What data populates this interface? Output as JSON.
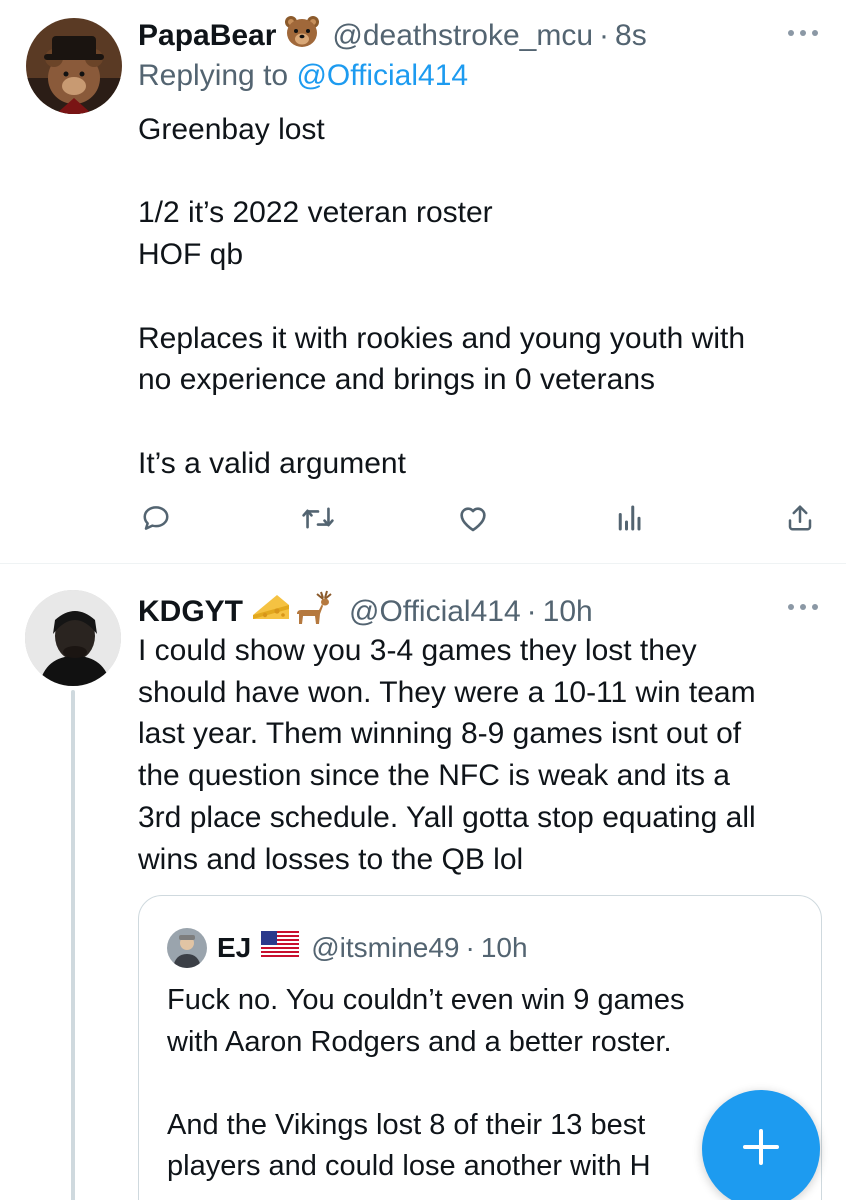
{
  "tweet1": {
    "name": "PapaBear",
    "emoji": "bear-face-emoji",
    "handle": "@deathstroke_mcu",
    "separator": "·",
    "time": "8s",
    "reply_prefix": "Replying to",
    "reply_to": "@Official414",
    "text": "Greenbay lost\n\n1/2 it’s 2022 veteran roster\nHOF qb\n\nReplaces it with rookies and young youth with\nno experience  and brings in 0 veterans\n\nIt’s a valid argument",
    "actions": [
      "reply-icon",
      "retweet-icon",
      "like-icon",
      "views-icon",
      "share-icon"
    ]
  },
  "tweet2": {
    "name": "KDGYT",
    "emojis": [
      "cheese-emoji",
      "deer-emoji"
    ],
    "handle": "@Official414",
    "separator": "·",
    "time": "10h",
    "text": "I could show you 3-4 games they lost they\nshould have won. They were a 10-11 win team\nlast year. Them winning 8-9 games isnt out of\nthe question since the NFC is weak and its a\n3rd place schedule. Yall gotta stop equating all\nwins and losses to the QB lol"
  },
  "quote": {
    "name": "EJ",
    "flag": "us-flag-emoji",
    "handle": "@itsmine49",
    "separator": "·",
    "time": "10h",
    "text": "Fuck no. You couldn’t even win 9 games\nwith Aaron Rodgers and a better roster.\n\nAnd the Vikings lost 8 of their 13 best\nplayers and could lose another with H"
  },
  "fab": {
    "icon": "plus-icon"
  },
  "colors": {
    "accent": "#1d9bf0",
    "text": "#0f1419",
    "secondary": "#536471",
    "border": "#cfd9de"
  }
}
